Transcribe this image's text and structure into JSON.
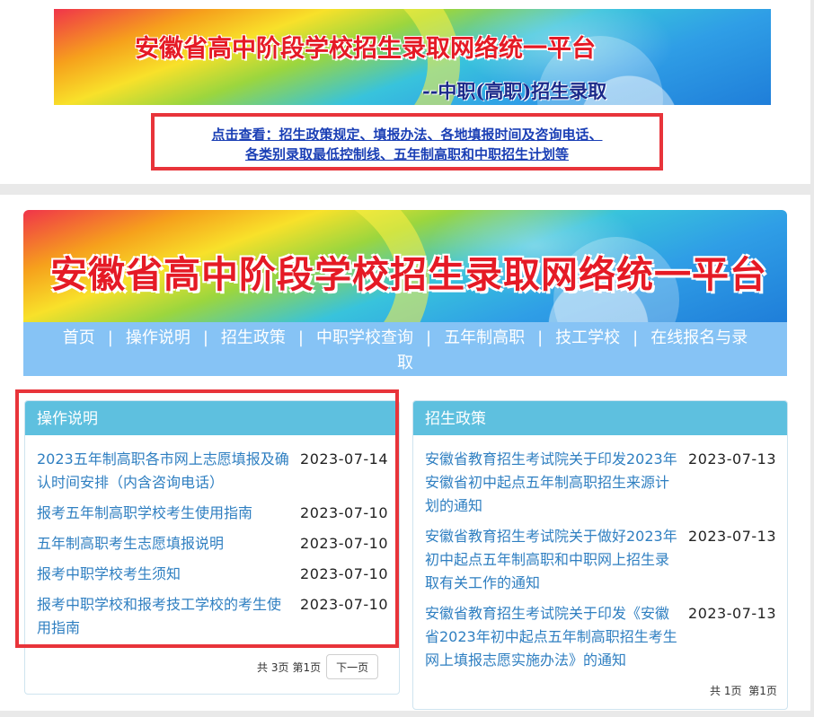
{
  "top_banner": {
    "title": "安徽省高中阶段学校招生录取网络统一平台",
    "subtitle": "--中职(高职)招生录取"
  },
  "notice": {
    "line1": "点击查看：招生政策规定、填报办法、各地填报时间及咨询电话、",
    "line2": "各类别录取最低控制线、五年制高职和中职招生计划等"
  },
  "main_banner": {
    "title": "安徽省高中阶段学校招生录取网络统一平台"
  },
  "nav": {
    "items": [
      "首页",
      "操作说明",
      "招生政策",
      "中职学校查询",
      "五年制高职",
      "技工学校",
      "在线报名与录取"
    ],
    "separator": "|"
  },
  "left_panel": {
    "title": "操作说明",
    "items": [
      {
        "title": "2023五年制高职各市网上志愿填报及确认时间安排（内含咨询电话）",
        "date": "2023-07-14"
      },
      {
        "title": "报考五年制高职学校考生使用指南",
        "date": "2023-07-10"
      },
      {
        "title": "五年制高职考生志愿填报说明",
        "date": "2023-07-10"
      },
      {
        "title": "报考中职学校考生须知",
        "date": "2023-07-10"
      },
      {
        "title": "报考中职学校和报考技工学校的考生使用指南",
        "date": "2023-07-10"
      }
    ],
    "pager": {
      "total": "共 3页",
      "current": "第1页",
      "next": "下一页"
    }
  },
  "right_panel": {
    "title": "招生政策",
    "items": [
      {
        "title": "安徽省教育招生考试院关于印发2023年安徽省初中起点五年制高职招生来源计划的通知",
        "date": "2023-07-13"
      },
      {
        "title": "安徽省教育招生考试院关于做好2023年初中起点五年制高职和中职网上招生录取有关工作的通知",
        "date": "2023-07-13"
      },
      {
        "title": "安徽省教育招生考试院关于印发《安徽省2023年初中起点五年制高职招生考生网上填报志愿实施办法》的通知",
        "date": "2023-07-13"
      }
    ],
    "pager": {
      "total": "共 1页",
      "current": "第1页"
    }
  },
  "colors": {
    "title_red": "#e51a25",
    "nav_bg": "#86c3f5",
    "panel_header": "#5ec0df",
    "link_blue": "#2f7fc1",
    "highlight_frame": "#e8343a"
  }
}
